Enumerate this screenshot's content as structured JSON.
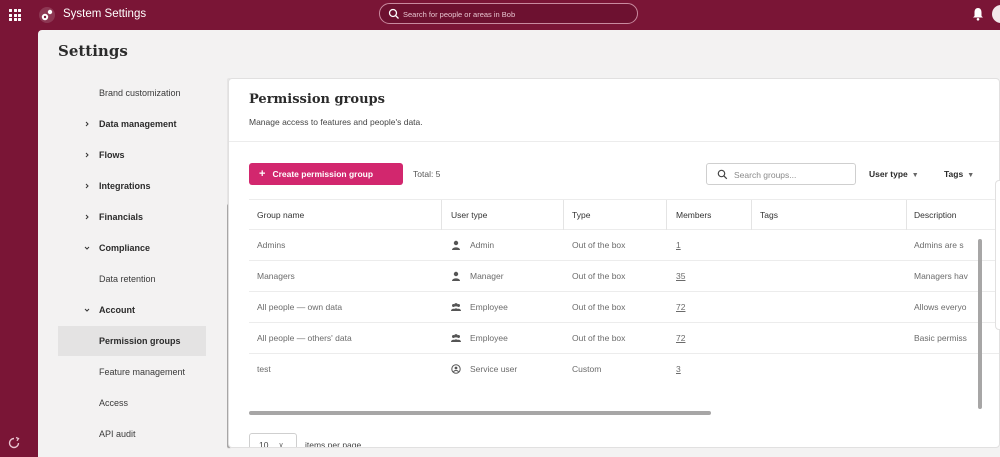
{
  "topbar": {
    "app_title": "System Settings",
    "search_placeholder": "Search for people or areas in Bob",
    "brand_color": "#7a1536"
  },
  "page": {
    "title": "Settings"
  },
  "sidebar": {
    "items": [
      {
        "label": "Brand customization",
        "expandable": false,
        "state": "none"
      },
      {
        "label": "Data management",
        "expandable": true,
        "state": "collapsed"
      },
      {
        "label": "Flows",
        "expandable": true,
        "state": "collapsed"
      },
      {
        "label": "Integrations",
        "expandable": true,
        "state": "collapsed"
      },
      {
        "label": "Financials",
        "expandable": true,
        "state": "collapsed"
      },
      {
        "label": "Compliance",
        "expandable": true,
        "state": "expanded"
      },
      {
        "label": "Data retention",
        "expandable": false,
        "state": "none"
      },
      {
        "label": "Account",
        "expandable": true,
        "state": "expanded"
      },
      {
        "label": "Permission groups",
        "expandable": false,
        "state": "active"
      },
      {
        "label": "Feature management",
        "expandable": false,
        "state": "none"
      },
      {
        "label": "Access",
        "expandable": false,
        "state": "none"
      },
      {
        "label": "API audit",
        "expandable": false,
        "state": "none"
      }
    ]
  },
  "card": {
    "title": "Permission groups",
    "subtitle": "Manage access to features and people's data.",
    "create_label": "Create permission group",
    "total_label": "Total: 5",
    "search_placeholder": "Search groups...",
    "filter_user_type": "User type",
    "filter_tags": "Tags",
    "accent_color": "#d2276e"
  },
  "table": {
    "columns": [
      "Group name",
      "User type",
      "Type",
      "Members",
      "Tags",
      "Description"
    ],
    "rows": [
      {
        "name": "Admins",
        "user_type": "Admin",
        "user_icon": "person-icon",
        "type": "Out of the box",
        "members": "1",
        "tags": "",
        "description": "Admins are s"
      },
      {
        "name": "Managers",
        "user_type": "Manager",
        "user_icon": "person-icon",
        "type": "Out of the box",
        "members": "35",
        "tags": "",
        "description": "Managers hav"
      },
      {
        "name": "All people — own data",
        "user_type": "Employee",
        "user_icon": "people-group-icon",
        "type": "Out of the box",
        "members": "72",
        "tags": "",
        "description": "Allows everyo"
      },
      {
        "name": "All people — others' data",
        "user_type": "Employee",
        "user_icon": "people-group-icon",
        "type": "Out of the box",
        "members": "72",
        "tags": "",
        "description": "Basic permiss"
      },
      {
        "name": "test",
        "user_type": "Service user",
        "user_icon": "service-user-icon",
        "type": "Custom",
        "members": "3",
        "tags": "",
        "description": ""
      }
    ]
  },
  "pagination": {
    "page_size": "10",
    "label": "items per page"
  }
}
